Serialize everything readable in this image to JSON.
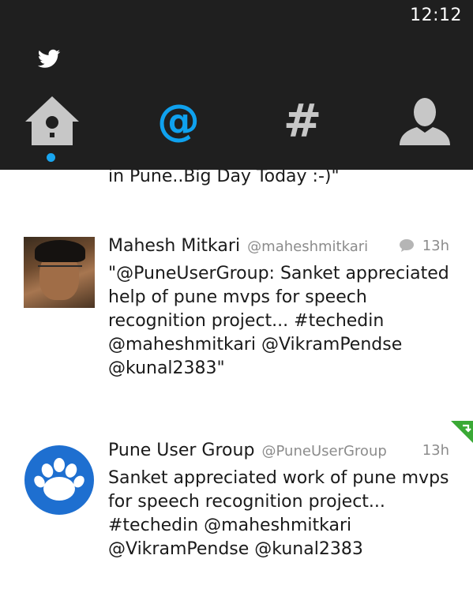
{
  "status_bar": {
    "time": "12:12"
  },
  "header": {
    "app_icon": "twitter-bird-icon",
    "nav": [
      {
        "name": "home",
        "icon": "birdhouse-icon",
        "has_unread": true
      },
      {
        "name": "mentions",
        "icon": "at-icon",
        "glyph": "@",
        "active": true
      },
      {
        "name": "hashtags",
        "icon": "hash-icon",
        "glyph": "#"
      },
      {
        "name": "profile",
        "icon": "person-icon"
      }
    ]
  },
  "feed": {
    "partial_previous_text": "in Pune..Big Day Today :-)\"",
    "tweets": [
      {
        "author_name": "Mahesh Mitkari",
        "author_handle": "@maheshmitkari",
        "time": "13h",
        "has_reply_icon": true,
        "lines": [
          "\"@PuneUserGroup: Sanket appreciated",
          "help of pune mvps for speech",
          "recognition project... #techedin",
          "@maheshmitkari @VikramPendse",
          "@kunal2383\""
        ]
      },
      {
        "author_name": "Pune User Group",
        "author_handle": "@PuneUserGroup",
        "time": "13h",
        "retweeted": true,
        "lines": [
          "Sanket appreciated work of pune mvps",
          "for speech recognition project...",
          "#techedin @maheshmitkari",
          "@VikramPendse @kunal2383"
        ]
      }
    ]
  },
  "colors": {
    "header_bg": "#1f1f1f",
    "accent": "#0fa1ee",
    "inactive_icon": "#c7c7c7",
    "muted_text": "#8c8c8c",
    "retweet_green": "#3aa935"
  }
}
